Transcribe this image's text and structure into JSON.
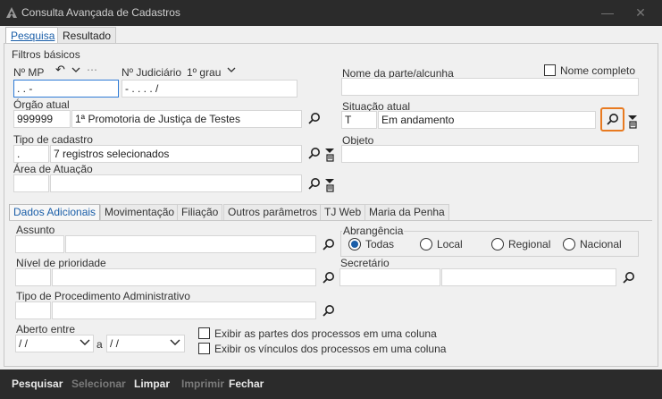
{
  "window": {
    "title": "Consulta Avançada de Cadastros"
  },
  "tabs": [
    {
      "label": "Pesquisa",
      "active": true
    },
    {
      "label": "Resultado",
      "active": false
    }
  ],
  "filtros": {
    "group_title": "Filtros básicos",
    "nmp": {
      "label": "Nº MP",
      "value": ".   .          -"
    },
    "judiciario": {
      "label": "Nº Judiciário",
      "grau": "1º grau",
      "value": "-   .   .   .  .     /"
    },
    "nome_parte": {
      "label": "Nome da parte/alcunha",
      "value": ""
    },
    "nome_completo": {
      "label": "Nome completo",
      "checked": false
    },
    "orgao": {
      "label": "Órgão atual",
      "code": "999999",
      "name": "1ª Promotoria de Justiça de Testes"
    },
    "situacao": {
      "label": "Situação atual",
      "code": "T",
      "name": "Em andamento"
    },
    "tipo_cadastro": {
      "label": "Tipo de cadastro",
      "code": ".",
      "name": "7 registros selecionados"
    },
    "objeto": {
      "label": "Objeto",
      "value": ""
    },
    "area": {
      "label": "Área de Atuação",
      "code": "",
      "name": ""
    }
  },
  "subtabs": [
    {
      "label": "Dados Adicionais",
      "active": true
    },
    {
      "label": "Movimentação",
      "active": false
    },
    {
      "label": "Filiação",
      "active": false
    },
    {
      "label": "Outros parâmetros",
      "active": false
    },
    {
      "label": "TJ Web",
      "active": false
    },
    {
      "label": "Maria da Penha",
      "active": false
    }
  ],
  "adicionais": {
    "assunto": {
      "label": "Assunto"
    },
    "abrangencia": {
      "label": "Abrangência",
      "options": [
        {
          "label": "Todas",
          "selected": true
        },
        {
          "label": "Local",
          "selected": false
        },
        {
          "label": "Regional",
          "selected": false
        },
        {
          "label": "Nacional",
          "selected": false
        }
      ]
    },
    "prioridade": {
      "label": "Nível de prioridade"
    },
    "secretario": {
      "label": "Secretário"
    },
    "procedimento": {
      "label": "Tipo de Procedimento Administrativo"
    },
    "aberto": {
      "label": "Aberto entre",
      "from": " / /",
      "to": " / /",
      "sep": "a"
    },
    "exibir_partes": {
      "label": "Exibir as partes dos processos em uma coluna",
      "checked": false
    },
    "exibir_vinculos": {
      "label": "Exibir os vínculos dos processos em uma coluna",
      "checked": false
    }
  },
  "bottom": {
    "pesquisar": "Pesquisar",
    "selecionar": "Selecionar",
    "limpar": "Limpar",
    "imprimir": "Imprimir",
    "fechar": "Fechar"
  },
  "colors": {
    "titlebar": "#2b2b2b",
    "accent": "#1a5ea8",
    "highlight": "#e87a20"
  }
}
